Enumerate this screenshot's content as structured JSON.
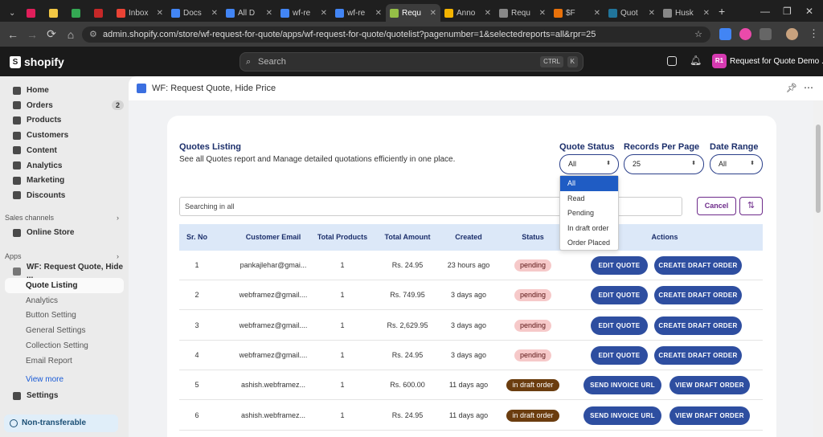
{
  "browser": {
    "tabs": [
      {
        "label": "Inbox",
        "color": "#ea4335"
      },
      {
        "label": "Docs",
        "color": "#4285f4"
      },
      {
        "label": "All D",
        "color": "#4285f4"
      },
      {
        "label": "wf-re",
        "color": "#4285f4"
      },
      {
        "label": "wf-re",
        "color": "#4285f4"
      },
      {
        "label": "Requ",
        "color": "#95bf47",
        "active": true
      },
      {
        "label": "Anno",
        "color": "#f4b400"
      },
      {
        "label": "Requ",
        "color": "#888888"
      },
      {
        "label": "$F",
        "color": "#e8710a"
      },
      {
        "label": "Quot",
        "color": "#21759b"
      },
      {
        "label": "Husk",
        "color": "#888888"
      }
    ],
    "url": "admin.shopify.com/store/wf-request-for-quote/apps/wf-request-for-quote/quotelist?pagenumber=1&selectedreports=all&rpr=25"
  },
  "shopify": {
    "logo": "shopify",
    "search_placeholder": "Search",
    "shortcut_ctrl": "CTRL",
    "shortcut_k": "K",
    "store_initials": "R1",
    "store_name": "Request for Quote Demo ..."
  },
  "sidebar": {
    "items": [
      {
        "label": "Home"
      },
      {
        "label": "Orders",
        "badge": "2"
      },
      {
        "label": "Products"
      },
      {
        "label": "Customers"
      },
      {
        "label": "Content"
      },
      {
        "label": "Analytics"
      },
      {
        "label": "Marketing"
      },
      {
        "label": "Discounts"
      }
    ],
    "sales_channels_label": "Sales channels",
    "online_store": "Online Store",
    "apps_label": "Apps",
    "app_name": "WF: Request Quote, Hide ...",
    "app_subitems": [
      "Quote Listing",
      "Analytics",
      "Button Setting",
      "General Settings",
      "Collection Setting",
      "Email Report"
    ],
    "view_more": "View more",
    "settings": "Settings",
    "non_transferable": "Non-transferable"
  },
  "app_header": {
    "title": "WF: Request Quote, Hide Price"
  },
  "listing": {
    "title": "Quotes Listing",
    "subtitle": "See all Quotes report and Manage detailed quotations efficiently in one place.",
    "filters": {
      "quote_status_label": "Quote Status",
      "quote_status_value": "All",
      "records_label": "Records Per Page",
      "records_value": "25",
      "date_range_label": "Date Range",
      "date_range_value": "All"
    },
    "status_options": [
      "All",
      "Read",
      "Pending",
      "In draft order",
      "Order Placed"
    ],
    "search_placeholder": "Searching in all",
    "cancel_label": "Cancel",
    "columns": [
      "Sr. No",
      "Customer Email",
      "Total Products",
      "Total Amount",
      "Created",
      "Status",
      "Actions"
    ],
    "rows": [
      {
        "sr": "1",
        "email": "pankajlehar@gmai...",
        "products": "1",
        "amount": "Rs. 24.95",
        "created": "23 hours ago",
        "status": "pending",
        "btn1": "EDIT QUOTE",
        "btn2": "CREATE DRAFT ORDER"
      },
      {
        "sr": "2",
        "email": "webframez@gmail....",
        "products": "1",
        "amount": "Rs. 749.95",
        "created": "3 days ago",
        "status": "pending",
        "btn1": "EDIT QUOTE",
        "btn2": "CREATE DRAFT ORDER"
      },
      {
        "sr": "3",
        "email": "webframez@gmail....",
        "products": "1",
        "amount": "Rs. 2,629.95",
        "created": "3 days ago",
        "status": "pending",
        "btn1": "EDIT QUOTE",
        "btn2": "CREATE DRAFT ORDER"
      },
      {
        "sr": "4",
        "email": "webframez@gmail....",
        "products": "1",
        "amount": "Rs. 24.95",
        "created": "3 days ago",
        "status": "pending",
        "btn1": "EDIT QUOTE",
        "btn2": "CREATE DRAFT ORDER"
      },
      {
        "sr": "5",
        "email": "ashish.webframez...",
        "products": "1",
        "amount": "Rs. 600.00",
        "created": "11 days ago",
        "status": "in draft order",
        "btn1": "SEND INVOICE URL",
        "btn2": "VIEW DRAFT ORDER"
      },
      {
        "sr": "6",
        "email": "ashish.webframez...",
        "products": "1",
        "amount": "Rs. 24.95",
        "created": "11 days ago",
        "status": "in draft order",
        "btn1": "SEND INVOICE URL",
        "btn2": "VIEW DRAFT ORDER"
      }
    ]
  }
}
